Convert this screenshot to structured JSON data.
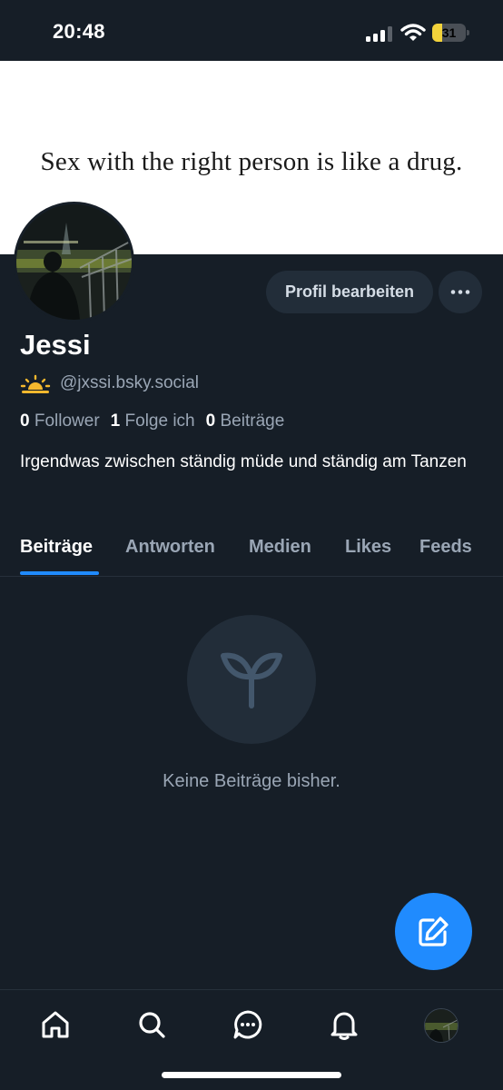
{
  "status_bar": {
    "time": "20:48",
    "battery_level": "31",
    "battery_fraction": 0.31,
    "battery_color": "#f3d33b",
    "icons": [
      "signal-icon",
      "wifi-icon",
      "battery-icon"
    ]
  },
  "profile": {
    "banner_text": "Sex with the right person is like a drug.",
    "display_name": "Jessi",
    "handle": "@jxssi.bsky.social",
    "handle_emoji": "sunrise-icon",
    "edit_button_label": "Profil bearbeiten",
    "more_button_icon": "ellipsis-icon",
    "bio": "Irgendwas zwischen ständig müde und ständig am Tanzen",
    "stats": {
      "followers_count": "0",
      "followers_label": "Follower",
      "following_count": "1",
      "following_label": "Folge ich",
      "posts_count": "0",
      "posts_label": "Beiträge"
    }
  },
  "tabs": [
    {
      "label": "Beiträge",
      "active": true
    },
    {
      "label": "Antworten",
      "active": false
    },
    {
      "label": "Medien",
      "active": false
    },
    {
      "label": "Likes",
      "active": false
    },
    {
      "label": "Feeds",
      "active": false
    }
  ],
  "empty_state": {
    "icon": "sprout-icon",
    "text": "Keine Beiträge bisher."
  },
  "fab_icon": "compose-icon",
  "bottom_nav": {
    "items": [
      "home-icon",
      "search-icon",
      "chat-icon",
      "bell-icon",
      "profile-avatar"
    ]
  },
  "colors": {
    "background": "#161e27",
    "accent": "#208bfe",
    "surface": "#222d39",
    "muted_text": "#9aa6b5"
  }
}
